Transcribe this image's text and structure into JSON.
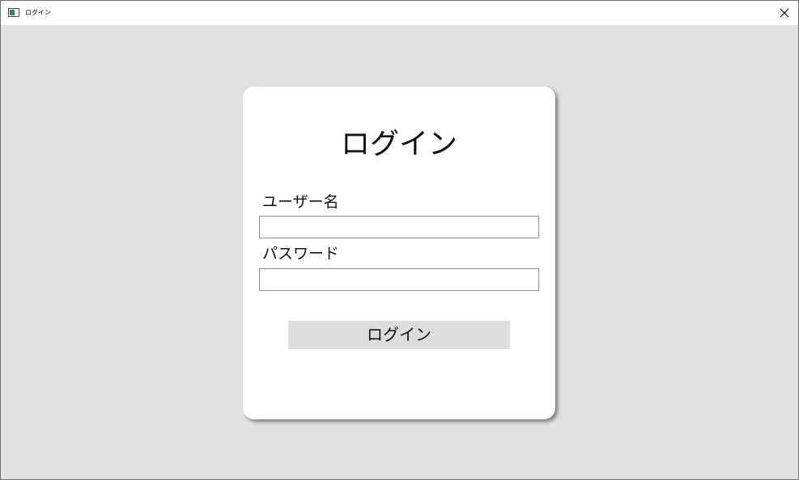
{
  "window": {
    "title": "ログイン",
    "close_icon": "close-icon",
    "app_icon": "window-app-icon"
  },
  "login_card": {
    "heading": "ログイン",
    "username_label": "ユーザー名",
    "username_value": "",
    "username_placeholder": "",
    "password_label": "パスワード",
    "password_value": "",
    "password_placeholder": "",
    "login_button_label": "ログイン"
  },
  "colors": {
    "background": "#e1e1e1",
    "card": "#ffffff",
    "button": "#dcdcdc",
    "input_border": "#8e8e8e"
  }
}
